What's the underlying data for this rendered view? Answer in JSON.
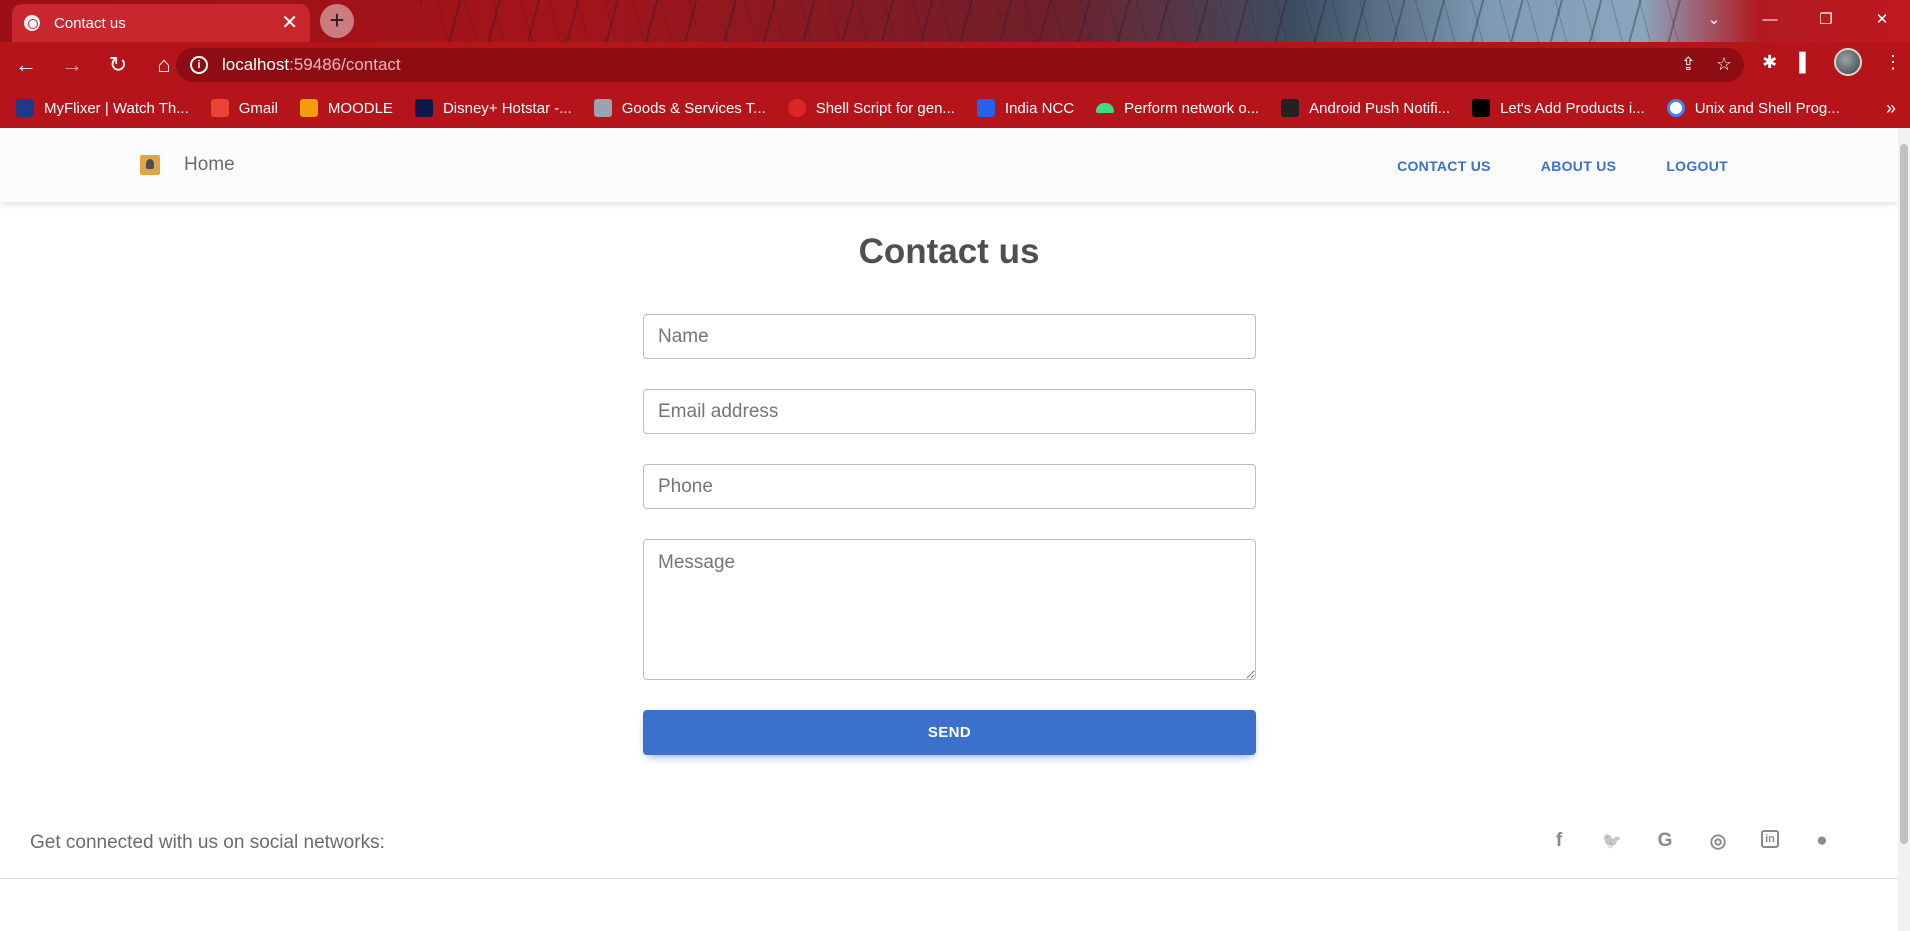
{
  "browser": {
    "tab_title": "Contact us",
    "tab_close": "✕",
    "new_tab": "+",
    "window": {
      "dropdown": "⌄",
      "minimize": "—",
      "restore": "❐",
      "close": "✕"
    },
    "nav": {
      "back": "←",
      "forward": "→",
      "reload": "↻",
      "home": "⌂"
    },
    "url_host": "localhost",
    "url_path": ":59486/contact",
    "info_icon": "i",
    "omnibox_icons": {
      "share": "⇪",
      "bookmark": "☆"
    },
    "toolbar_icons": {
      "extensions": "✱",
      "sidepanel": "▌",
      "menu": "⋮"
    },
    "bookmarks": [
      {
        "label": "MyFlixer | Watch Th...",
        "icon": "myflixer-icon",
        "color": "#1e3a8a"
      },
      {
        "label": "Gmail",
        "icon": "gmail-icon",
        "color": "#ea4335"
      },
      {
        "label": "MOODLE",
        "icon": "moodle-icon",
        "color": "#f59e0b"
      },
      {
        "label": "Disney+ Hotstar -...",
        "icon": "hotstar-icon",
        "color": "#0c1a4b"
      },
      {
        "label": "Goods & Services T...",
        "icon": "gst-icon",
        "color": "#9ca3af"
      },
      {
        "label": "Shell Script for gen...",
        "icon": "target-icon",
        "color": "#dc2626"
      },
      {
        "label": "India NCC",
        "icon": "ncc-icon",
        "color": "#2563eb"
      },
      {
        "label": "Perform network o...",
        "icon": "android-icon",
        "color": "#3ddc84"
      },
      {
        "label": "Android Push Notifi...",
        "icon": "v-icon",
        "color": "#222222"
      },
      {
        "label": "Let's Add Products i...",
        "icon": "medium-icon",
        "color": "#000000"
      },
      {
        "label": "Unix and Shell Prog...",
        "icon": "google-icon",
        "color": "#4285f4"
      }
    ],
    "bookmarks_more": "»",
    "accent_color": "#b5141b"
  },
  "navbar": {
    "brand": "Home",
    "links": [
      "CONTACT US",
      "ABOUT US",
      "LOGOUT"
    ]
  },
  "main": {
    "title": "Contact us",
    "form": {
      "name_placeholder": "Name",
      "email_placeholder": "Email address",
      "phone_placeholder": "Phone",
      "message_placeholder": "Message",
      "submit_label": "SEND"
    },
    "button_color": "#3b71ca"
  },
  "footer": {
    "text": "Get connected with us on social networks:",
    "social": [
      {
        "name": "facebook-icon",
        "glyph": "f"
      },
      {
        "name": "twitter-icon",
        "glyph": "🐦"
      },
      {
        "name": "google-icon",
        "glyph": "G"
      },
      {
        "name": "instagram-icon",
        "glyph": "◎"
      },
      {
        "name": "linkedin-icon",
        "glyph": "in"
      },
      {
        "name": "github-icon",
        "glyph": "●"
      }
    ]
  }
}
